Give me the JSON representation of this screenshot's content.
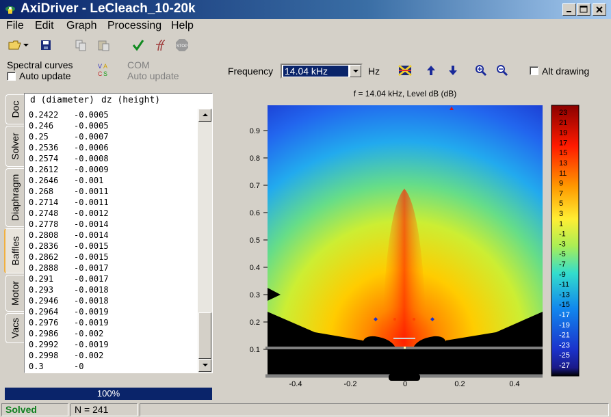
{
  "window": {
    "title": "AxiDriver - LeCleach_10-20k"
  },
  "menu": [
    "File",
    "Edit",
    "Graph",
    "Processing",
    "Help"
  ],
  "toolbar_icons": [
    "open-folder-icon",
    "dropdown-arrow-icon",
    "save-icon",
    "copy-icon",
    "paste-icon",
    "check-icon",
    "ff-icon",
    "stop-icon"
  ],
  "options": {
    "spectral_label": "Spectral curves",
    "auto_update_label": "Auto update",
    "auto_update_checked": false,
    "com_label": "COM",
    "com_auto_update_label": "Auto update",
    "frequency_label": "Frequency",
    "frequency_value": "14.04 kHz",
    "hz_label": "Hz",
    "alt_drawing_label": "Alt drawing",
    "alt_drawing_checked": false
  },
  "tabs": [
    "Doc",
    "Solver",
    "Diaphragm",
    "Baffles",
    "Motor",
    "Vacs"
  ],
  "active_tab": "Baffles",
  "list": {
    "col_d": "d (diameter)",
    "col_dz": "dz (height)",
    "rows": [
      [
        "0.2422",
        "-0.0005"
      ],
      [
        "0.246",
        "-0.0005"
      ],
      [
        "0.25",
        "-0.0007"
      ],
      [
        "0.2536",
        "-0.0006"
      ],
      [
        "0.2574",
        "-0.0008"
      ],
      [
        "0.2612",
        "-0.0009"
      ],
      [
        "0.2646",
        "-0.001"
      ],
      [
        "0.268",
        "-0.0011"
      ],
      [
        "0.2714",
        "-0.0011"
      ],
      [
        "0.2748",
        "-0.0012"
      ],
      [
        "0.2778",
        "-0.0014"
      ],
      [
        "0.2808",
        "-0.0014"
      ],
      [
        "0.2836",
        "-0.0015"
      ],
      [
        "0.2862",
        "-0.0015"
      ],
      [
        "0.2888",
        "-0.0017"
      ],
      [
        "0.291",
        "-0.0017"
      ],
      [
        "0.293",
        "-0.0018"
      ],
      [
        "0.2946",
        "-0.0018"
      ],
      [
        "0.2964",
        "-0.0019"
      ],
      [
        "0.2976",
        "-0.0019"
      ],
      [
        "0.2986",
        "-0.002"
      ],
      [
        "0.2992",
        "-0.0019"
      ],
      [
        "0.2998",
        "-0.002"
      ],
      [
        "0.3",
        "-0"
      ]
    ]
  },
  "progress": {
    "label": "100%",
    "value": 1.0
  },
  "status": {
    "state": "Solved",
    "n": "N = 241"
  },
  "plot": {
    "title": "f = 14.04 kHz, Level dB  (dB)",
    "x_ticks": [
      "-0.4",
      "-0.2",
      "0",
      "0.2",
      "0.4"
    ],
    "y_ticks": [
      "0.1",
      "0.2",
      "0.3",
      "0.4",
      "0.5",
      "0.6",
      "0.7",
      "0.8",
      "0.9"
    ],
    "colorbar_ticks": [
      "23",
      "21",
      "19",
      "17",
      "15",
      "13",
      "11",
      "9",
      "7",
      "5",
      "3",
      "1",
      "-1",
      "-3",
      "-5",
      "-7",
      "-9",
      "-11",
      "-13",
      "-15",
      "-17",
      "-19",
      "-21",
      "-23",
      "-25",
      "-27"
    ]
  }
}
